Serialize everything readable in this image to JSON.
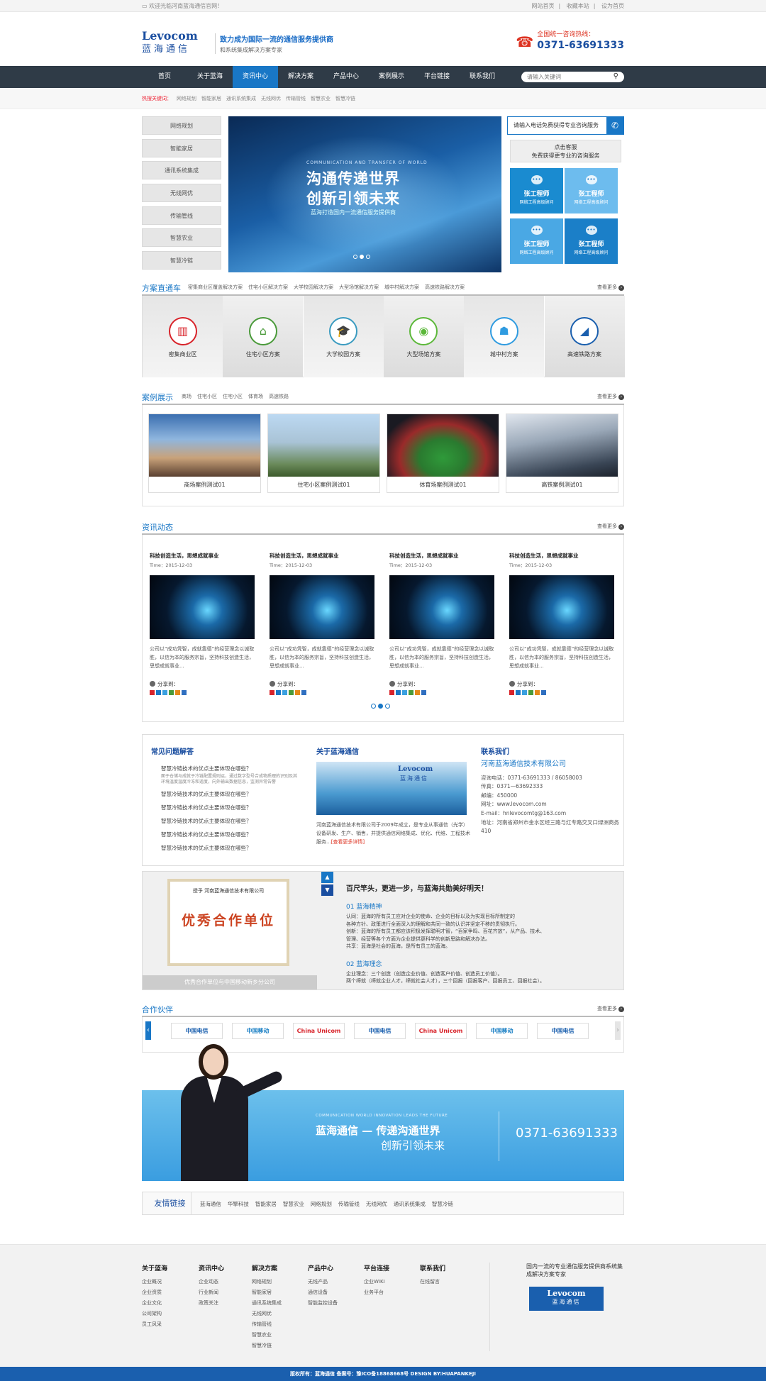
{
  "topbar": {
    "welcome": "欢迎光临河南蓝海通信官网！",
    "links": [
      "网站首页",
      "收藏本站",
      "设为首页"
    ]
  },
  "header": {
    "logo_en": "Levocom",
    "logo_cn": "蓝海通信",
    "slogan1": "致力成为国际一流的通信服务提供商",
    "slogan2": "和系统集成解决方案专家",
    "hotline_label": "全国统一咨询热线：",
    "hotline": "0371-63691333"
  },
  "nav": {
    "items": [
      "首页",
      "关于蓝海",
      "资讯中心",
      "解决方案",
      "产品中心",
      "案例展示",
      "平台链接",
      "联系我们"
    ],
    "active": 2
  },
  "search": {
    "placeholder": "请输入关键词"
  },
  "hotwords": {
    "label": "热搜关键词：",
    "words": [
      "网络规划",
      "智能家居",
      "通讯系统集成",
      "无线网优",
      "传输管线",
      "智慧农业",
      "智慧冷链"
    ]
  },
  "leftmenu": [
    "网络规划",
    "智能家居",
    "通讯系统集成",
    "无线网优",
    "传输管线",
    "智慧农业",
    "智慧冷链"
  ],
  "slider": {
    "en": "COMMUNICATION AND TRANSFER OF WORLD",
    "line1": "沟通传递世界",
    "line2": "创新引领未来",
    "line3": "蓝海打造国内一流通信服务提供商"
  },
  "consult": {
    "title": "请输入电话免费获得专业咨询服务",
    "box_line1": "点击客服",
    "box_line2": "免费获得更专业的咨询服务",
    "engineers": [
      {
        "name": "张工程师",
        "role": "网络工程高级顾问"
      },
      {
        "name": "张工程师",
        "role": "网络工程高级顾问"
      },
      {
        "name": "张工程师",
        "role": "网络工程高级顾问"
      },
      {
        "name": "张工程师",
        "role": "网络工程高级顾问"
      }
    ],
    "colors": [
      "#1a8bd0",
      "#6dbcee",
      "#4aa8e4",
      "#1b7fc8"
    ]
  },
  "solutions": {
    "title": "方案直通车",
    "tabs": [
      "密集商业区覆盖解决方案",
      "住宅小区解决方案",
      "大学校园解决方案",
      "大型场馆解决方案",
      "城中村解决方案",
      "高速铁路解决方案"
    ],
    "more": "查看更多",
    "items": [
      {
        "name": "密集商业区",
        "color": "#d8232a",
        "icon": "▥"
      },
      {
        "name": "住宅小区方案",
        "color": "#4a9a3a",
        "icon": "⌂"
      },
      {
        "name": "大学校园方案",
        "color": "#3a9bc0",
        "icon": "🎓"
      },
      {
        "name": "大型场馆方案",
        "color": "#5cb83a",
        "icon": "◉"
      },
      {
        "name": "城中村方案",
        "color": "#2f9be0",
        "icon": "☗"
      },
      {
        "name": "高速铁路方案",
        "color": "#1a5fae",
        "icon": "◢"
      }
    ]
  },
  "cases": {
    "title": "案例展示",
    "tabs": [
      "商场",
      "住宅小区",
      "住宅小区",
      "体育场",
      "高速铁路"
    ],
    "more": "查看更多",
    "items": [
      "商场案例测试01",
      "住宅小区案例测试01",
      "体育场案例测试01",
      "高铁案例测试01"
    ]
  },
  "news": {
    "title": "资讯动态",
    "more": "查看更多",
    "share": "分享到：",
    "items": [
      {
        "title": "科技创造生活，思想成就事业",
        "time": "Time：2015-12-03",
        "desc": "公司以“成功凭智，成就靠德”的经营理念以诚取胜，以信为本的服务宗旨，坚持科技创造生活，思想成就事业..."
      },
      {
        "title": "科技创造生活，思想成就事业",
        "time": "Time：2015-12-03",
        "desc": "公司以“成功凭智，成就靠德”的经营理念以诚取胜，以信为本的服务宗旨，坚持科技创造生活，思想成就事业..."
      },
      {
        "title": "科技创造生活，思想成就事业",
        "time": "Time：2015-12-03",
        "desc": "公司以“成功凭智，成就靠德”的经营理念以诚取胜，以信为本的服务宗旨，坚持科技创造生活，思想成就事业..."
      },
      {
        "title": "科技创造生活，思想成就事业",
        "time": "Time：2015-12-03",
        "desc": "公司以“成功凭智，成就靠德”的经营理念以诚取胜，以信为本的服务宗旨，坚持科技创造生活，思想成就事业..."
      }
    ]
  },
  "faq": {
    "title": "常见问题解答",
    "q": "智慧冷链技术的优点主要体现在哪些？",
    "answer": "面于仓储与成就于冷链配置规则运，通过数字型号合成物质理的识别及其环境温度温度冷冻和适度，向外输出数据信息，监测异常告警"
  },
  "about": {
    "title": "关于蓝海通信",
    "pic_en": "Levocom",
    "pic_cn": "蓝海通信",
    "text": "河南蓝海通信技术有限公司于2009年成立，是专业从事通信（光学）设备研发、生产、销售，并提供通信网络集成、优化、代维、工程技术服务...",
    "more": "[查看更多详情]"
  },
  "contact": {
    "title": "联系我们",
    "company": "河南蓝海通信技术有限公司",
    "lines": [
      "咨询电话：0371-63691333 / 86058003",
      "传真：0371—63692333",
      "邮编：450000",
      "网址：www.levocom.com",
      "E-mail：hnlevocomtg@163.com",
      "地址：河南省郑州市金水区经三路与红专路交叉口绿洲商务410"
    ]
  },
  "culture": {
    "cert_title": "授予 河南蓝海通信技术有限公司",
    "cert_big": "优秀合作单位",
    "cert_caption": "优秀合作单位与中国移动新乡分公司",
    "heading": "百尺竿头，更进一步，与蓝海共勋美好明天！",
    "s1_title": "01 蓝海精神",
    "s1_text": [
      "认同：蓝海的所有员工应对企业的使命、企业的目标以及为实现目标所制定的",
      "各种方针、政策进行全面深入的理解和共同一致的认识并坚定不移的贯彻执行。",
      "创新：蓝海的所有员工都应该积极发挥聪明才智，“百家争鸣、百花齐放”，从产品、技术、",
      "管理、经营等各个方面为企业提供更科学的创新思路和解决办法。",
      "共享：蓝海是社会的蓝海，是所有员工的蓝海。"
    ],
    "s2_title": "02 蓝海理念",
    "s2_text": [
      "企业理念：三个创造（创造企业价值、创造客户价值、创造员工价值）。",
      "两个缔就（缔就企业人才，缔就社会人才），三个回报（回报客户、回报员工、回报社会）。"
    ]
  },
  "partners": {
    "title": "合作伙伴",
    "more": "查看更多",
    "items": [
      {
        "name": "中国电信",
        "color": "#1a5fae"
      },
      {
        "name": "中国移动",
        "color": "#1a7fc4"
      },
      {
        "name": "China Unicom",
        "color": "#d8232a"
      },
      {
        "name": "中国电信",
        "color": "#1a5fae"
      },
      {
        "name": "China Unicom",
        "color": "#d8232a"
      },
      {
        "name": "中国移动",
        "color": "#1a7fc4"
      },
      {
        "name": "中国电信",
        "color": "#1a5fae"
      }
    ]
  },
  "promo": {
    "en": "COMMUNICATION WORLD INNOVATION LEADS THE FUTURE",
    "line1": "蓝海通信 — 传递沟通世界",
    "line2": "创新引领未来",
    "tel": "0371-63691333"
  },
  "links": {
    "title": "友情链接",
    "items": [
      "蓝海通信",
      "华擎科技",
      "智能家居",
      "智慧农业",
      "网络规划",
      "传输管线",
      "无线网优",
      "通讯系统集成",
      "智慧冷链"
    ]
  },
  "footer": {
    "cols": [
      {
        "title": "关于蓝海",
        "items": [
          "企业概况",
          "企业资质",
          "企业文化",
          "公司架构",
          "员工风采"
        ]
      },
      {
        "title": "资讯中心",
        "items": [
          "企业动态",
          "行业新闻",
          "政策关注"
        ]
      },
      {
        "title": "解决方案",
        "items": [
          "网络规划",
          "智能家居",
          "通讯系统集成",
          "无线网优",
          "传输管线",
          "智慧农业",
          "智慧冷链"
        ]
      },
      {
        "title": "产品中心",
        "items": [
          "无线产品",
          "通信设备",
          "智能监控设备"
        ]
      },
      {
        "title": "平台连接",
        "items": [
          "企业WIKI",
          "业务平台"
        ]
      },
      {
        "title": "联系我们",
        "items": [
          "在线留言"
        ]
      }
    ],
    "slogan": "国内一流的专业通信服务提供商系统集成解决方案专家",
    "logo_en": "Levocom",
    "logo_cn": "蓝海通信"
  },
  "copyright": "版权所有：蓝海通信  备案号：豫ICO备18868668号  DESIGN BY:HUAPANKEJI"
}
